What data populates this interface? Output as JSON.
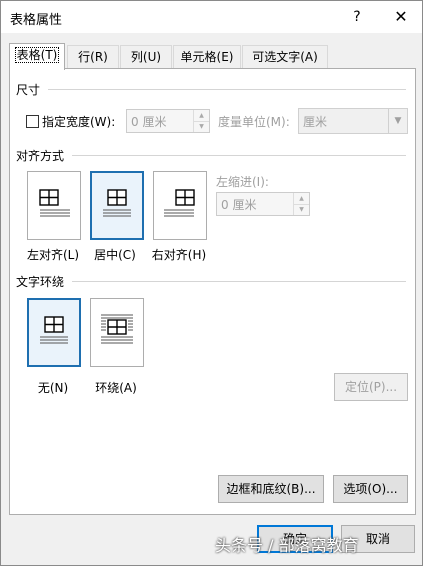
{
  "window": {
    "title": "表格属性",
    "help": "?",
    "close": "✕"
  },
  "tabs": [
    {
      "label": "表格(T)"
    },
    {
      "label": "行(R)"
    },
    {
      "label": "列(U)"
    },
    {
      "label": "单元格(E)"
    },
    {
      "label": "可选文字(A)"
    }
  ],
  "size": {
    "heading": "尺寸",
    "specify_width_label": "指定宽度(W):",
    "specify_width_checked": false,
    "width_value": "0 厘米",
    "unit_label": "度量单位(M):",
    "unit_value": "厘米"
  },
  "alignment": {
    "heading": "对齐方式",
    "options": [
      {
        "label": "左对齐(L)",
        "selected": false
      },
      {
        "label": "居中(C)",
        "selected": true
      },
      {
        "label": "右对齐(H)",
        "selected": false
      }
    ],
    "indent_label": "左缩进(I):",
    "indent_value": "0 厘米"
  },
  "wrapping": {
    "heading": "文字环绕",
    "options": [
      {
        "label": "无(N)",
        "selected": true
      },
      {
        "label": "环绕(A)",
        "selected": false
      }
    ],
    "position_button": "定位(P)..."
  },
  "buttons": {
    "borders_shading": "边框和底纹(B)...",
    "options": "选项(O)...",
    "ok": "确定",
    "cancel": "取消"
  },
  "watermark": "头条号 / 部落窝教育",
  "colors": {
    "accent": "#1e6fb0",
    "focus_border": "#0078d7"
  }
}
